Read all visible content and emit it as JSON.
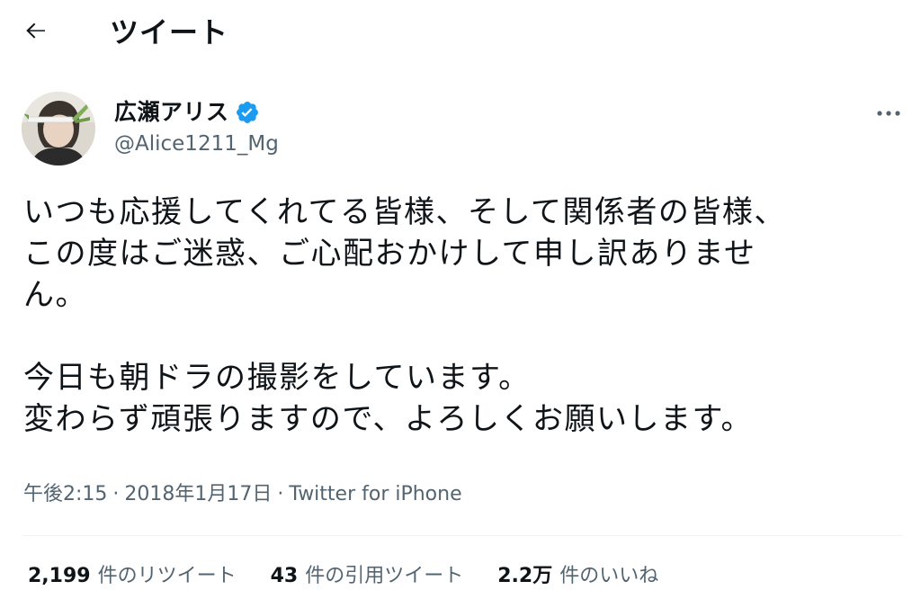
{
  "header": {
    "back_icon": "arrow-left-icon",
    "title": "ツイート"
  },
  "author": {
    "display_name": "広瀬アリス",
    "verified_icon": "verified-badge-icon",
    "verified_color": "#1d9bf0",
    "handle": "@Alice1211_Mg",
    "more_icon": "more-horizontal-icon"
  },
  "tweet": {
    "text": "いつも応援してくれてる皆様、そして関係者の皆様、\nこの度はご迷惑、ご心配おかけして申し訳ありませ\nん。\n\n今日も朝ドラの撮影をしています。\n変わらず頑張りますので、よろしくお願いします。",
    "time": "午後2:15",
    "separator": "·",
    "date": "2018年1月17日",
    "source": "Twitter for iPhone"
  },
  "stats": {
    "retweets": {
      "count": "2,199",
      "label": "件のリツイート"
    },
    "quotes": {
      "count": "43",
      "label": "件の引用ツイート"
    },
    "likes": {
      "count": "2.2万",
      "label": "件のいいね"
    }
  }
}
